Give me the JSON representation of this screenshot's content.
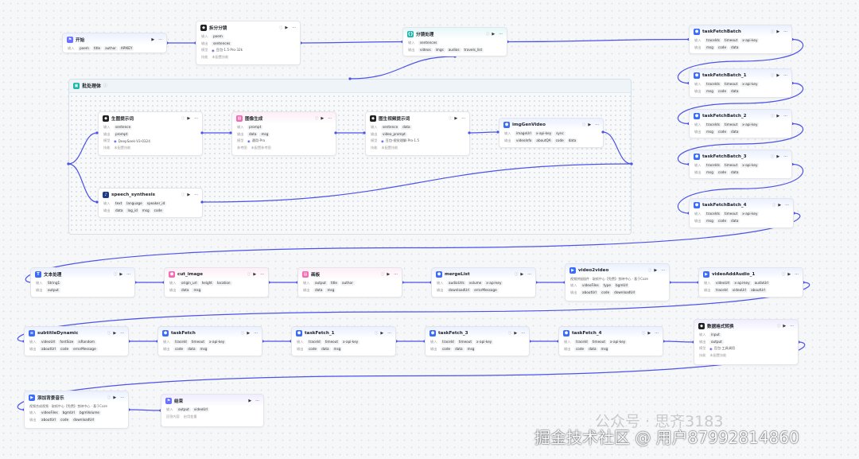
{
  "loop": {
    "title": "批处理体",
    "icon": "batch-icon",
    "color": "#1fb5a9"
  },
  "labels": {
    "in": "输入",
    "out": "输出",
    "model": "模型",
    "param": "参数"
  },
  "nodes": {
    "start": {
      "title": "开始",
      "icon": "start-icon",
      "color": "#6a70ff",
      "in_tags": [
        "poem",
        "title",
        "author",
        "APIKEY"
      ]
    },
    "split": {
      "title": "拆分分镜",
      "icon": "llm-icon",
      "color": "#222222",
      "in_tags": [
        "poem"
      ],
      "out_tags": [
        "sentences"
      ],
      "model": "豆包·1.5·Pro·32k",
      "extra_label": "技能",
      "extra": "未配置技能"
    },
    "shot": {
      "title": "分镜处理",
      "icon": "code-icon",
      "color": "#1fb5a9",
      "in_tags": [
        "sentences"
      ],
      "out_tags": [
        "videos",
        "imgs",
        "audios",
        "travels_list"
      ]
    },
    "gen_prompt": {
      "title": "生图提示词",
      "icon": "llm-icon",
      "color": "#222222",
      "in_tags": [
        "sentence"
      ],
      "out_tags": [
        "prompt"
      ],
      "model": "DeepSeek-V3-0324",
      "extra_label": "技能",
      "extra": "未配置技能"
    },
    "img_gen": {
      "title": "图像生成",
      "icon": "image-icon",
      "color": "#f26bb5",
      "in_tags": [
        "prompt"
      ],
      "out_tags": [
        "data",
        "msg"
      ],
      "model": "通用-Pro",
      "extra_label": "参考图",
      "extra": "未配置参考图"
    },
    "vid_prompt": {
      "title": "图生视频提示词",
      "icon": "llm-icon",
      "color": "#222222",
      "in_tags": [
        "sentence",
        "data"
      ],
      "out_tags": [
        "video_prompt"
      ],
      "model": "豆包·视觉理解·Pro·1.5",
      "extra_label": "技能",
      "extra": "未配置技能"
    },
    "imgGenVideo": {
      "title": "imgGenVideo",
      "icon": "plugin-icon",
      "color": "#3c6cf5",
      "in_tags": [
        "imageUrl",
        "x-api-key",
        "sync"
      ],
      "out_tags": [
        "videoInfo",
        "aboutQA",
        "code",
        "data"
      ]
    },
    "speech": {
      "title": "speech_synthesis",
      "icon": "audio-icon",
      "color": "#1e3a8a",
      "in_tags": [
        "text",
        "language",
        "speaker_id"
      ],
      "out_tags": [
        "data",
        "log_id",
        "msg",
        "code"
      ]
    },
    "tfb0": {
      "title": "taskFetchBatch",
      "icon": "plugin-icon",
      "color": "#3c6cf5",
      "in_tags": [
        "traceIds",
        "timeout",
        "x-api-key"
      ],
      "out_tags": [
        "msg",
        "code",
        "data"
      ]
    },
    "tfb1": {
      "title": "taskFetchBatch_1",
      "icon": "plugin-icon",
      "color": "#3c6cf5",
      "in_tags": [
        "traceIds",
        "timeout",
        "x-api-key"
      ],
      "out_tags": [
        "msg",
        "code",
        "data"
      ]
    },
    "tfb2": {
      "title": "taskFetchBatch_2",
      "icon": "plugin-icon",
      "color": "#3c6cf5",
      "in_tags": [
        "traceIds",
        "timeout",
        "x-api-key"
      ],
      "out_tags": [
        "msg",
        "code",
        "data"
      ]
    },
    "tfb3": {
      "title": "taskFetchBatch_3",
      "icon": "plugin-icon",
      "color": "#3c6cf5",
      "in_tags": [
        "traceIds",
        "timeout",
        "x-api-key"
      ],
      "out_tags": [
        "msg",
        "code",
        "data"
      ]
    },
    "tfb4": {
      "title": "taskFetchBatch_4",
      "icon": "plugin-icon",
      "color": "#3c6cf5",
      "in_tags": [
        "traceIds",
        "timeout",
        "x-api-key"
      ],
      "out_tags": [
        "msg",
        "code",
        "data"
      ]
    },
    "text_proc": {
      "title": "文本处理",
      "icon": "text-icon",
      "color": "#3c6cf5",
      "in_tags": [
        "String1"
      ],
      "out_tags": [
        "output"
      ]
    },
    "cut_image": {
      "title": "cut_image",
      "icon": "plugin-icon",
      "color": "#f26bb5",
      "in_tags": [
        "origin_url",
        "height",
        "location"
      ],
      "out_tags": [
        "data",
        "msg"
      ]
    },
    "caption": {
      "title": "画板",
      "icon": "board-icon",
      "color": "#f26bb5",
      "in_tags": [
        "output",
        "title",
        "author"
      ],
      "out_tags": [
        "data",
        "msg"
      ]
    },
    "mergeList": {
      "title": "mergeList",
      "icon": "plugin-icon",
      "color": "#3c6cf5",
      "in_tags": [
        "audioUrls",
        "volume",
        "x-api-key"
      ],
      "out_tags": [
        "downloadUrl",
        "errorMessage"
      ]
    },
    "video2video": {
      "title": "video2video",
      "icon": "video-icon",
      "color": "#3c6cf5",
      "desc": "视频拼接插件 · 取帧中心【免费】· 剪映中心 · 基于Coze",
      "in_tags": [
        "videoFiles",
        "type",
        "bgmUrl"
      ],
      "out_tags": [
        "aboutUrl",
        "code",
        "downloadUrl"
      ]
    },
    "vaa1": {
      "title": "videoAddAudio_1",
      "icon": "video-icon",
      "color": "#3c6cf5",
      "in_tags": [
        "videoUrl",
        "x-api-key",
        "audioUrl"
      ],
      "out_tags": [
        "traceId",
        "videoUrl",
        "aboutUrl"
      ]
    },
    "subtitle": {
      "title": "subtitleDynamic",
      "icon": "subtitle-icon",
      "color": "#3c6cf5",
      "in_tags": [
        "videoUrl",
        "fontSize",
        "isRandom"
      ],
      "out_tags": [
        "aboutUrl",
        "code",
        "errorMessage"
      ]
    },
    "tf0": {
      "title": "taskFetch",
      "icon": "plugin-icon",
      "color": "#3c6cf5",
      "in_tags": [
        "traceId",
        "timeout",
        "x-api-key"
      ],
      "out_tags": [
        "code",
        "data",
        "msg"
      ]
    },
    "tf1": {
      "title": "taskFetch_1",
      "icon": "plugin-icon",
      "color": "#3c6cf5",
      "in_tags": [
        "traceId",
        "timeout",
        "x-api-key"
      ],
      "out_tags": [
        "code",
        "data",
        "msg"
      ]
    },
    "tf3": {
      "title": "taskFetch_3",
      "icon": "plugin-icon",
      "color": "#3c6cf5",
      "in_tags": [
        "traceId",
        "timeout",
        "x-api-key"
      ],
      "out_tags": [
        "code",
        "data",
        "msg"
      ]
    },
    "tf4": {
      "title": "taskFetch_4",
      "icon": "plugin-icon",
      "color": "#3c6cf5",
      "in_tags": [
        "traceId",
        "timeout",
        "x-api-key"
      ],
      "out_tags": [
        "code",
        "data",
        "msg"
      ]
    },
    "format": {
      "title": "数据格式转换",
      "icon": "llm-icon",
      "color": "#222222",
      "in_tags": [
        "input"
      ],
      "out_tags": [
        "output"
      ],
      "model": "豆包·工具调用",
      "extra_label": "技能",
      "extra": "未配置技能"
    },
    "bgm": {
      "title": "添加背景音乐",
      "icon": "video-icon",
      "color": "#3c6cf5",
      "desc": "视频合成视频 · 取帧中心【免费】· 剪映中心 · 基于Coze",
      "in_tags": [
        "videoFiles",
        "bgmUrl",
        "bgmVolume"
      ],
      "out_tags": [
        "aboutUrl",
        "code",
        "downloadUrl"
      ]
    },
    "end": {
      "title": "结束",
      "icon": "end-icon",
      "color": "#6a70ff",
      "in_tags": [
        "output",
        "videoUrl"
      ],
      "extra_label": "回答内容",
      "extra": "启用变量"
    }
  },
  "watermark": {
    "wechat": "公众号 · 思齐3183",
    "site": "掘金技术社区 @ 用户87992814860"
  }
}
